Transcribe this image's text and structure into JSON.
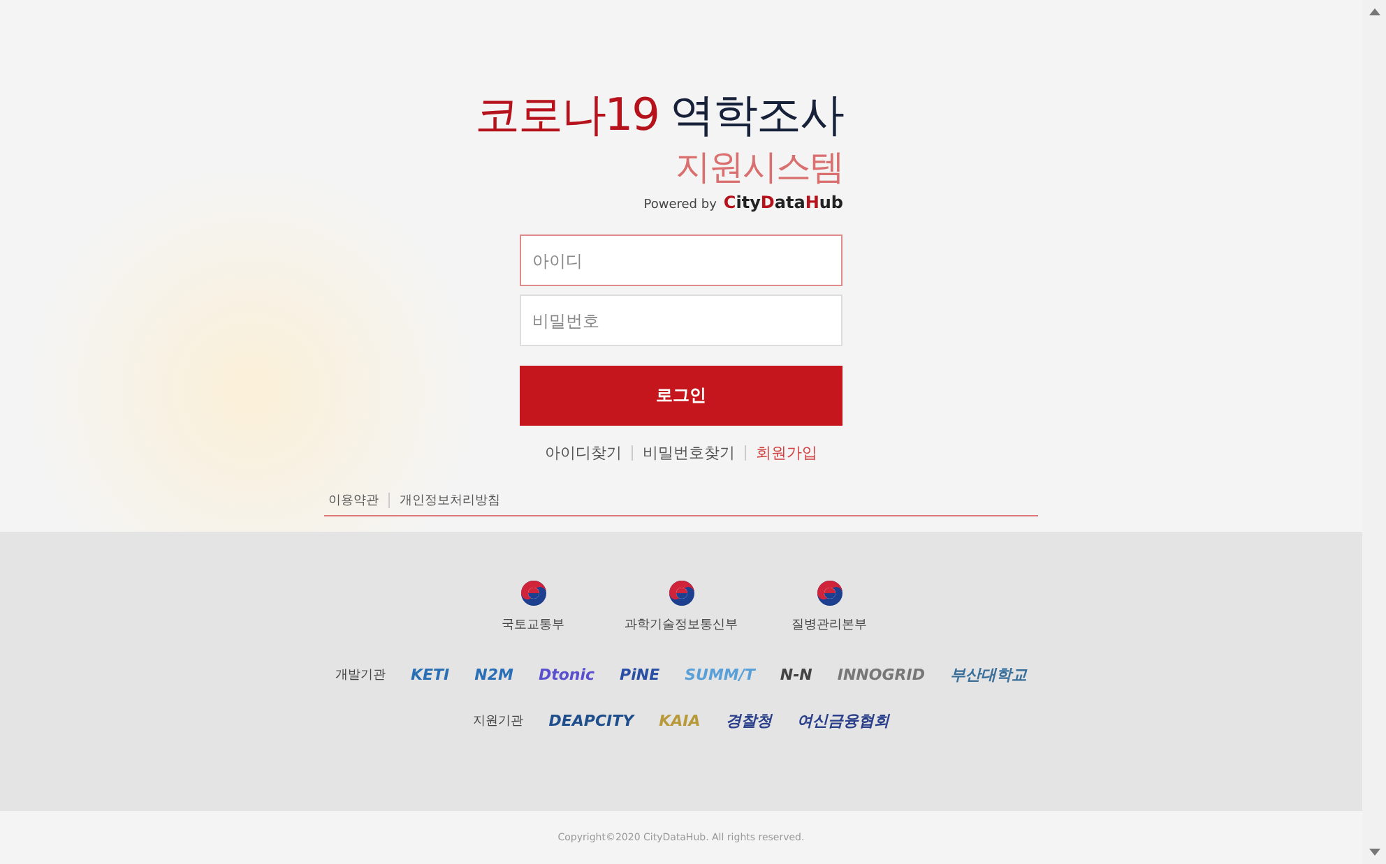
{
  "title": {
    "red": "코로나19",
    "dark": "역학조사",
    "subtitle": "지원시스템"
  },
  "powered": {
    "label": "Powered by",
    "brand_parts": [
      {
        "text": "C",
        "accent": true
      },
      {
        "text": "ity",
        "accent": false
      },
      {
        "text": "D",
        "accent": true
      },
      {
        "text": "ata",
        "accent": false
      },
      {
        "text": "H",
        "accent": true
      },
      {
        "text": "ub",
        "accent": false
      }
    ]
  },
  "login_form": {
    "fields": [
      {
        "placeholder": "아이디",
        "focused": true
      },
      {
        "placeholder": "비밀번호",
        "focused": false
      }
    ],
    "button": "로그인"
  },
  "links": [
    {
      "label": "아이디찾기",
      "highlight": false
    },
    {
      "label": "비밀번호찾기",
      "highlight": false
    },
    {
      "label": "회원가입",
      "highlight": true
    }
  ],
  "footer_links": [
    "이용약관",
    "개인정보처리방침"
  ],
  "agencies": [
    "국토교통부",
    "과학기술정보통신부",
    "질병관리본부"
  ],
  "developers": {
    "label": "개발기관",
    "logos": [
      {
        "text": "KETI",
        "color": "#2a6fb5"
      },
      {
        "text": "N2M",
        "color": "#2a6fb5"
      },
      {
        "text": "Dtonic",
        "color": "#5a4fcf"
      },
      {
        "text": "PiNE",
        "color": "#2a4fa5"
      },
      {
        "text": "SUMM/T",
        "color": "#5aa0d8"
      },
      {
        "text": "N-N",
        "color": "#444444"
      },
      {
        "text": "INNOGRID",
        "color": "#777777"
      },
      {
        "text": "부산대학교",
        "color": "#3a6f9a"
      }
    ]
  },
  "supporters": {
    "label": "지원기관",
    "logos": [
      {
        "text": "DEAPCITY",
        "color": "#1f4e8c"
      },
      {
        "text": "KAIA",
        "color": "#b89a3a"
      },
      {
        "text": "경찰청",
        "color": "#2a3f8a"
      },
      {
        "text": "여신금융협회",
        "color": "#2a3f8a"
      }
    ]
  },
  "copyright": "Copyright©2020 CityDataHub. All rights reserved."
}
